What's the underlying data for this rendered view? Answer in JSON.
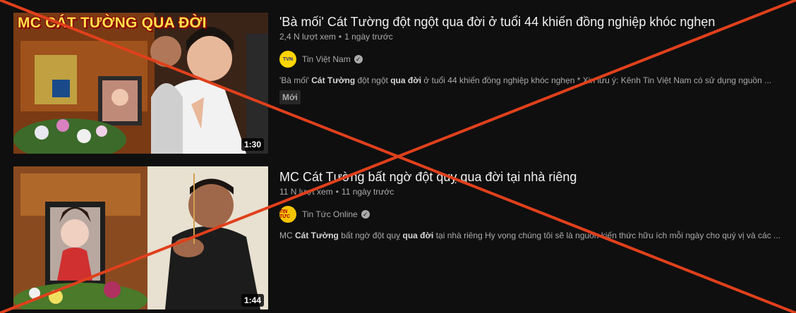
{
  "results": [
    {
      "thumb_text": "MC CÁT TƯỜNG QUA ĐỜI",
      "duration": "1:30",
      "title": "'Bà mối' Cát Tường đột ngột qua đời ở tuổi 44 khiến đồng nghiệp khóc nghẹn",
      "views": "2,4 N lượt xem",
      "sep": "•",
      "age": "1 ngày trước",
      "channel": "Tin Việt Nam",
      "avatar_text": "TVN",
      "verified_icon": "check",
      "desc_parts": [
        {
          "t": "'Bà mối' ",
          "b": false
        },
        {
          "t": "Cát Tường",
          "b": true
        },
        {
          "t": " đột ngột ",
          "b": false
        },
        {
          "t": "qua đời",
          "b": true
        },
        {
          "t": " ở tuổi 44 khiến đồng nghiệp khóc nghẹn * Xin lưu ý: Kênh Tin Việt Nam có sử dụng nguồn ...",
          "b": false
        }
      ],
      "badge": "Mới"
    },
    {
      "thumb_text": "",
      "duration": "1:44",
      "title": "MC Cát Tường bất ngờ đột quỵ qua đời tại nhà riêng",
      "views": "11 N lượt xem",
      "sep": "•",
      "age": "11 ngày trước",
      "channel": "Tin Tức Online",
      "avatar_text": "TIN TỨC",
      "verified_icon": "check",
      "desc_parts": [
        {
          "t": "MC ",
          "b": false
        },
        {
          "t": "Cát Tường",
          "b": true
        },
        {
          "t": " bất ngờ đột quỵ ",
          "b": false
        },
        {
          "t": "qua đời",
          "b": true
        },
        {
          "t": " tại nhà riêng Hy vọng chúng tôi sẽ là nguồn kiến thức hữu ích mỗi ngày cho quý vị và các ...",
          "b": false
        }
      ]
    }
  ],
  "colors": {
    "background": "#0f0f0f",
    "cross": "#e0401c",
    "thumb_text": "#ffe14a"
  }
}
